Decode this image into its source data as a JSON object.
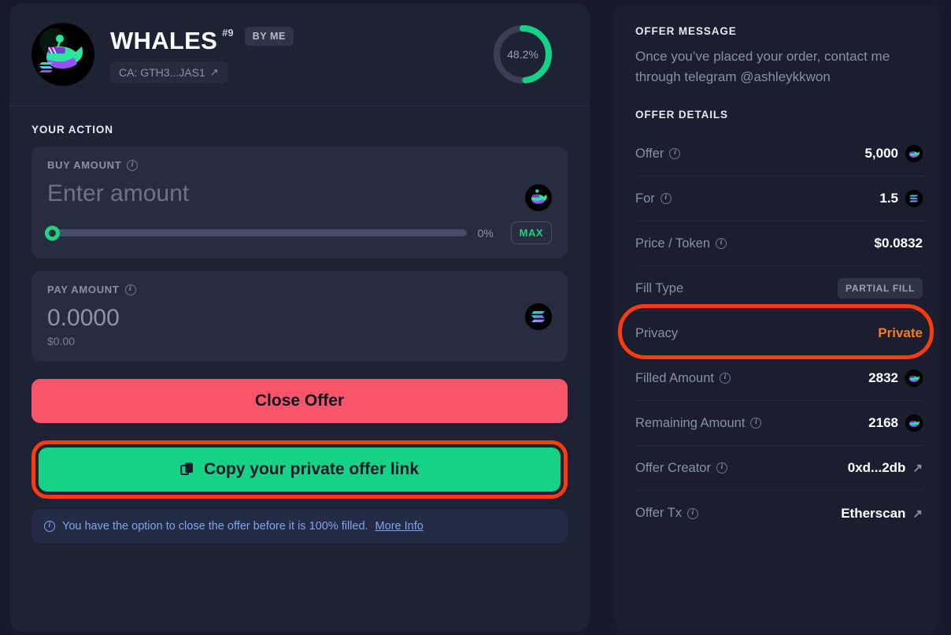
{
  "token": {
    "name": "WHALES",
    "rank": "#9",
    "by_me_badge": "BY ME",
    "contract_pill": "CA: GTH3...JAS1",
    "fill_percent_label": "48.2%",
    "fill_percent_value": 48.2,
    "accent_green": "#15d286",
    "ring_track": "#3a3f57"
  },
  "action": {
    "section_title": "YOUR ACTION",
    "buy": {
      "label": "BUY AMOUNT",
      "placeholder": "Enter amount",
      "value": "",
      "slider_percent_label": "0%",
      "slider_percent": 0,
      "max_label": "MAX"
    },
    "pay": {
      "label": "PAY AMOUNT",
      "value": "0.0000",
      "usd": "$0.00"
    },
    "close_offer_label": "Close Offer",
    "copy_link_label": "Copy your private offer link",
    "notice_text": "You have the option to close the offer before it is 100% filled.",
    "notice_link": "More Info"
  },
  "offer": {
    "message_heading": "OFFER MESSAGE",
    "message": "Once you’ve placed your order, contact me through telegram @ashleykkwon",
    "details_heading": "OFFER DETAILS",
    "rows": [
      {
        "label": "Offer",
        "info": true,
        "value": "5,000",
        "icon": "whale-coin"
      },
      {
        "label": "For",
        "info": true,
        "value": "1.5",
        "icon": "solana-coin"
      },
      {
        "label": "Price / Token",
        "info": true,
        "value": "$0.0832",
        "icon": ""
      },
      {
        "label": "Fill Type",
        "info": false,
        "value": "PARTIAL FILL",
        "icon": "chip"
      },
      {
        "label": "Privacy",
        "info": false,
        "value": "Private",
        "icon": "private"
      },
      {
        "label": "Filled Amount",
        "info": true,
        "value": "2832",
        "icon": "whale-coin"
      },
      {
        "label": "Remaining Amount",
        "info": true,
        "value": "2168",
        "icon": "whale-coin"
      },
      {
        "label": "Offer Creator",
        "info": true,
        "value": "0xd...2db",
        "icon": "external-link"
      },
      {
        "label": "Offer Tx",
        "info": true,
        "value": "Etherscan",
        "icon": "external-link"
      }
    ]
  },
  "highlight": {
    "color": "#fd3b0c"
  }
}
